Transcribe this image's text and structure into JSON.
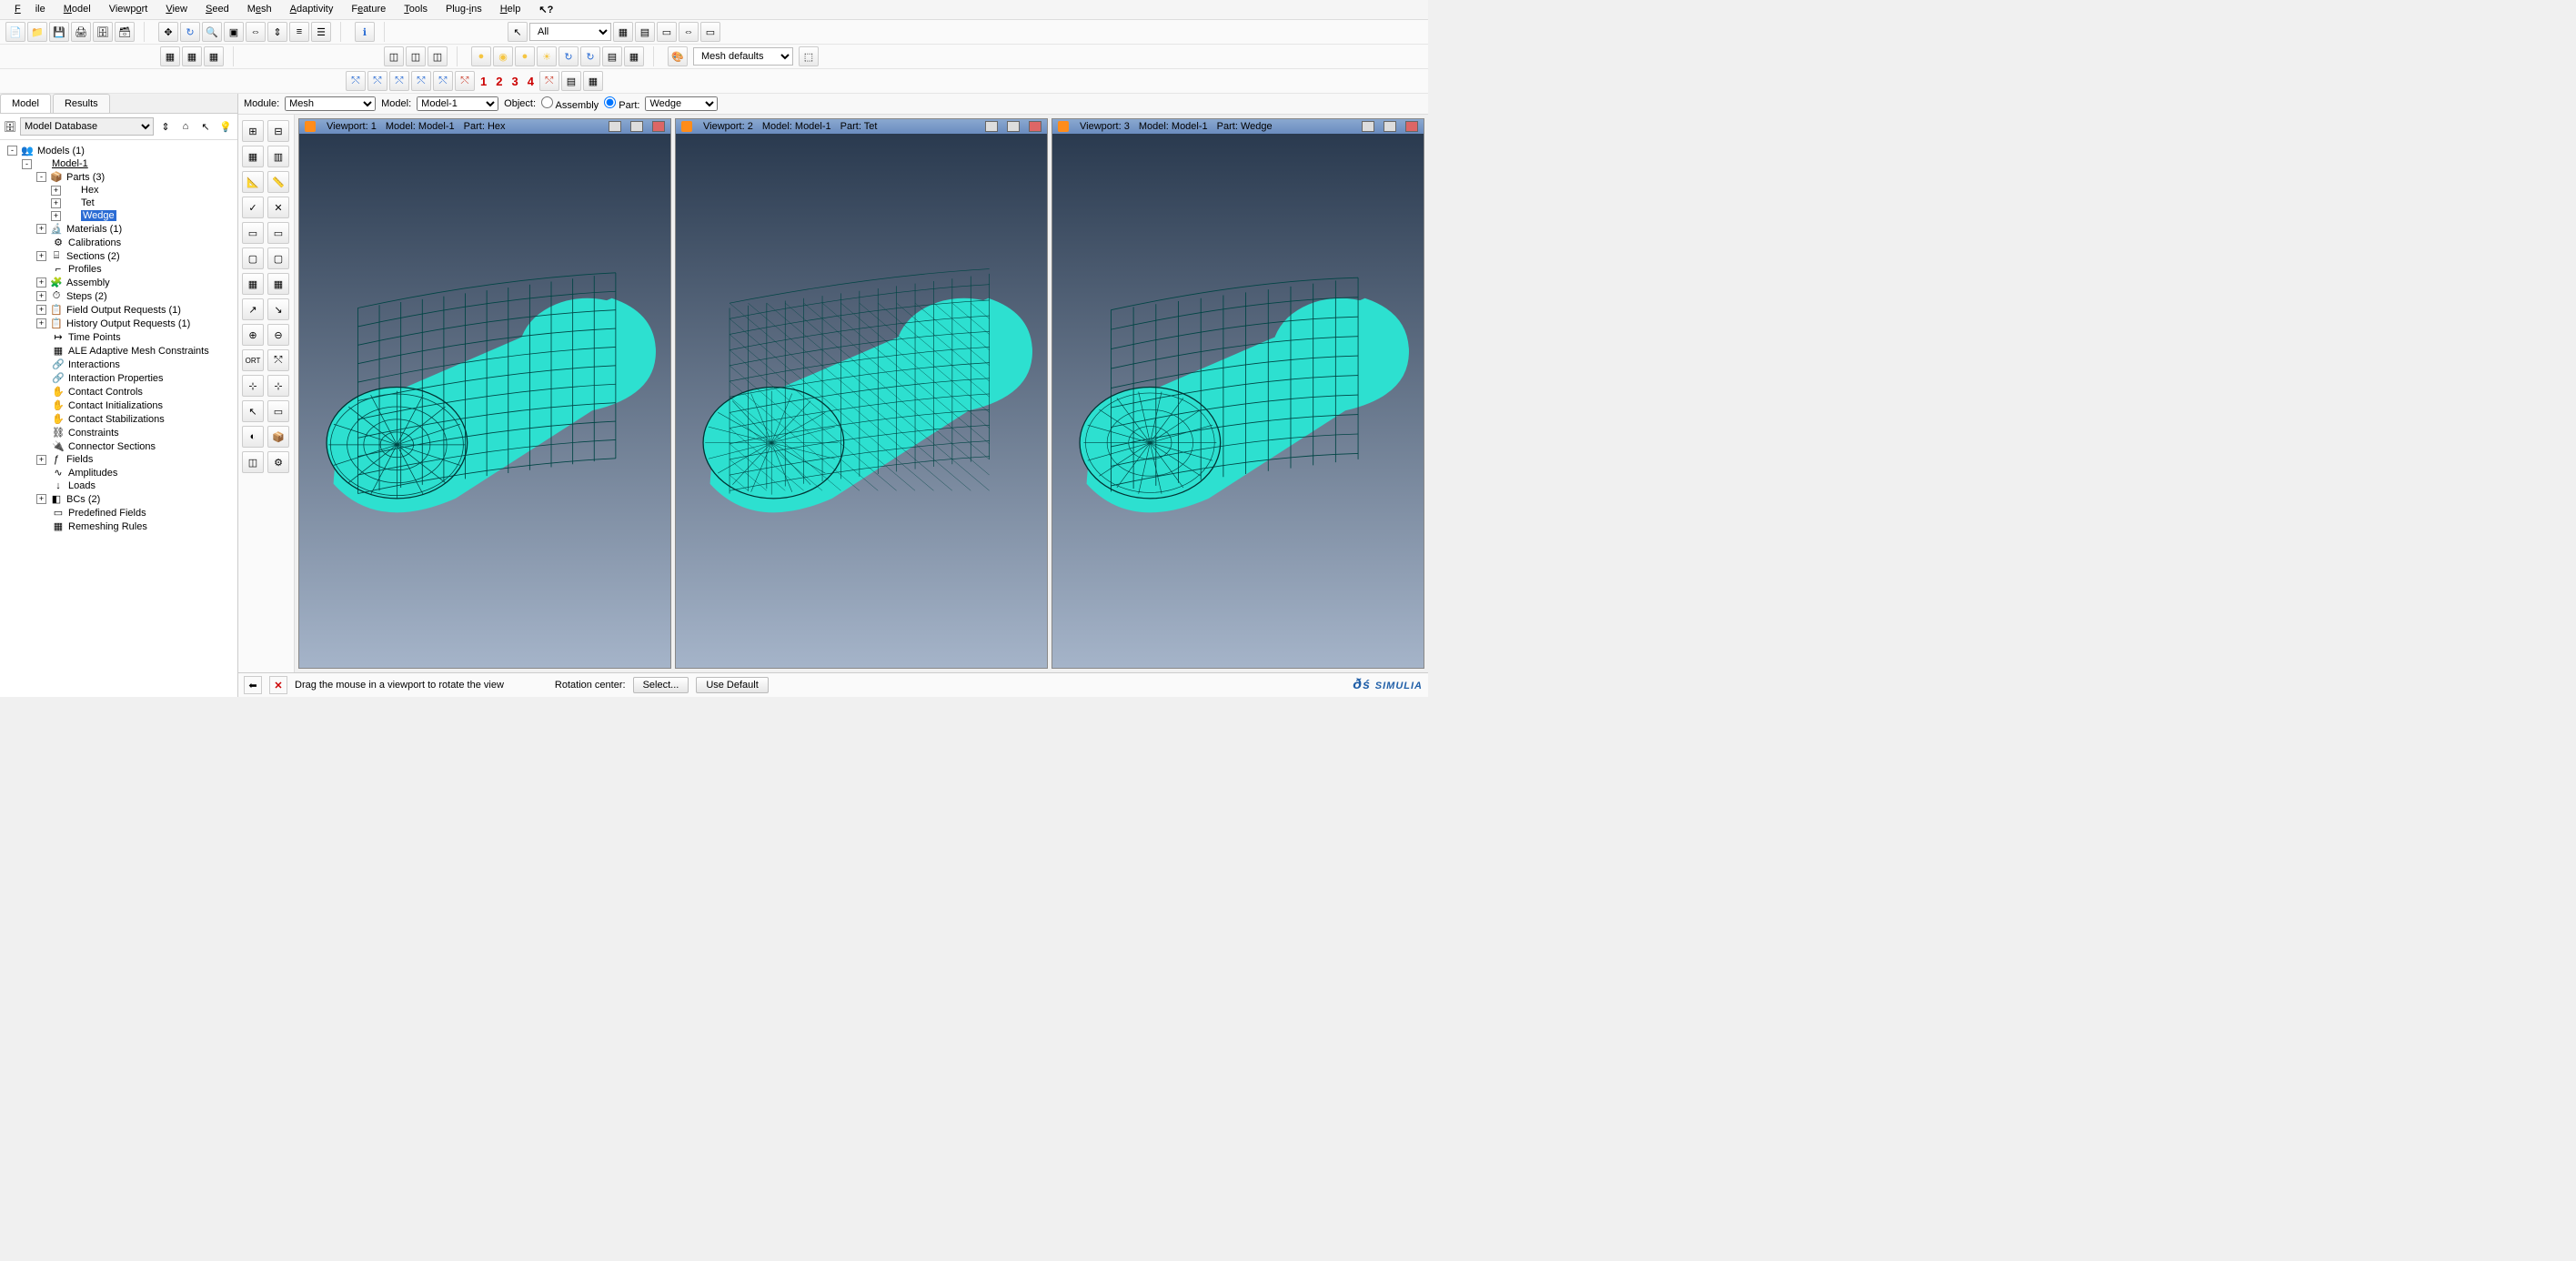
{
  "menu": [
    "File",
    "Model",
    "Viewport",
    "View",
    "Seed",
    "Mesh",
    "Adaptivity",
    "Feature",
    "Tools",
    "Plug-ins",
    "Help"
  ],
  "contextbar": {
    "module_label": "Module:",
    "module_value": "Mesh",
    "model_label": "Model:",
    "model_value": "Model-1",
    "object_label": "Object:",
    "radio_assembly": "Assembly",
    "radio_part": "Part:",
    "part_value": "Wedge"
  },
  "assembly_dropdown": "All",
  "mesh_defaults": "Mesh defaults",
  "view_numbers": [
    "1",
    "2",
    "3",
    "4"
  ],
  "tabs": {
    "model": "Model",
    "results": "Results"
  },
  "modeldb_label": "Model Database",
  "tree": [
    {
      "d": 0,
      "tw": "-",
      "ic": "👥",
      "label": "Models (1)"
    },
    {
      "d": 1,
      "tw": "-",
      "ic": "",
      "label": "Model-1",
      "underline": true
    },
    {
      "d": 2,
      "tw": "-",
      "ic": "📦",
      "label": "Parts (3)"
    },
    {
      "d": 3,
      "tw": "+",
      "ic": "",
      "label": "Hex"
    },
    {
      "d": 3,
      "tw": "+",
      "ic": "",
      "label": "Tet"
    },
    {
      "d": 3,
      "tw": "+",
      "ic": "",
      "label": "Wedge",
      "selected": true
    },
    {
      "d": 2,
      "tw": "+",
      "ic": "🔬",
      "label": "Materials (1)"
    },
    {
      "d": 2,
      "tw": "",
      "ic": "⚙",
      "label": "Calibrations"
    },
    {
      "d": 2,
      "tw": "+",
      "ic": "⌸",
      "label": "Sections (2)"
    },
    {
      "d": 2,
      "tw": "",
      "ic": "⌐",
      "label": "Profiles"
    },
    {
      "d": 2,
      "tw": "+",
      "ic": "🧩",
      "label": "Assembly"
    },
    {
      "d": 2,
      "tw": "+",
      "ic": "⏱",
      "label": "Steps (2)"
    },
    {
      "d": 2,
      "tw": "+",
      "ic": "📋",
      "label": "Field Output Requests (1)"
    },
    {
      "d": 2,
      "tw": "+",
      "ic": "📋",
      "label": "History Output Requests (1)"
    },
    {
      "d": 2,
      "tw": "",
      "ic": "↦",
      "label": "Time Points"
    },
    {
      "d": 2,
      "tw": "",
      "ic": "▦",
      "label": "ALE Adaptive Mesh Constraints"
    },
    {
      "d": 2,
      "tw": "",
      "ic": "🔗",
      "label": "Interactions"
    },
    {
      "d": 2,
      "tw": "",
      "ic": "🔗",
      "label": "Interaction Properties"
    },
    {
      "d": 2,
      "tw": "",
      "ic": "✋",
      "label": "Contact Controls"
    },
    {
      "d": 2,
      "tw": "",
      "ic": "✋",
      "label": "Contact Initializations"
    },
    {
      "d": 2,
      "tw": "",
      "ic": "✋",
      "label": "Contact Stabilizations"
    },
    {
      "d": 2,
      "tw": "",
      "ic": "⛓",
      "label": "Constraints"
    },
    {
      "d": 2,
      "tw": "",
      "ic": "🔌",
      "label": "Connector Sections"
    },
    {
      "d": 2,
      "tw": "+",
      "ic": "ƒ",
      "label": "Fields"
    },
    {
      "d": 2,
      "tw": "",
      "ic": "∿",
      "label": "Amplitudes"
    },
    {
      "d": 2,
      "tw": "",
      "ic": "↓",
      "label": "Loads"
    },
    {
      "d": 2,
      "tw": "+",
      "ic": "◧",
      "label": "BCs (2)"
    },
    {
      "d": 2,
      "tw": "",
      "ic": "▭",
      "label": "Predefined Fields"
    },
    {
      "d": 2,
      "tw": "",
      "ic": "▦",
      "label": "Remeshing Rules"
    }
  ],
  "viewports": [
    {
      "num": "1",
      "model": "Model-1",
      "part": "Hex"
    },
    {
      "num": "2",
      "model": "Model-1",
      "part": "Tet"
    },
    {
      "num": "3",
      "model": "Model-1",
      "part": "Wedge"
    }
  ],
  "vp_labels": {
    "viewport": "Viewport:",
    "model": "Model:",
    "part": "Part:"
  },
  "status": {
    "hint": "Drag the mouse in a viewport to rotate the view",
    "rotcenter": "Rotation center:",
    "select": "Select...",
    "usedefault": "Use Default",
    "brand": "SIMULIA"
  }
}
